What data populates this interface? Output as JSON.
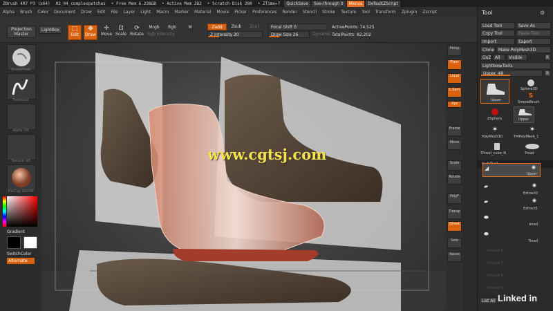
{
  "titlebar": {
    "app": "ZBrush 4R7 P3 (x64)",
    "doc": "02_04_complexpatches",
    "free_mem": "• Free Mem 6.238GB",
    "active_mem": "• Active Mem 382",
    "scratch": "• Scratch Disk 280",
    "ztime": "• ZTime▸7",
    "quicksave": "QuickSave",
    "see_through": "See-through  0",
    "menus": "Menus",
    "default_zscript": "DefaultZScript"
  },
  "menubar": [
    "Alpha",
    "Brush",
    "Color",
    "Document",
    "Draw",
    "Edit",
    "File",
    "Layer",
    "Light",
    "Macro",
    "Marker",
    "Material",
    "Movie",
    "Picker",
    "Preferences",
    "Render",
    "Stencil",
    "Stroke",
    "Texture",
    "Tool",
    "Transform",
    "Zplugin",
    "Zscript"
  ],
  "toolbar": {
    "projection_master": "Projection Master",
    "lightbox": "LightBox",
    "edit": "Edit",
    "draw": "Draw",
    "move": "Move",
    "scale": "Scale",
    "rotate": "Rotate",
    "mrgb": "Mrgb",
    "rgb": "Rgb",
    "m": "M",
    "rgb_intensity": "Rgb Intensity",
    "zadd": "Zadd",
    "zsub": "Zsub",
    "zcut": "Zcut",
    "z_intensity": "Z Intensity 20",
    "focal_shift": "Focal Shift 0",
    "draw_size": "Draw Size 26",
    "dynamic": "Dynamic",
    "active_points": "ActivePoints: 74,525",
    "total_points": "TotalPoints: 82,202",
    "z_intensity_value": 0.2,
    "draw_size_value": 0.26
  },
  "leftshelf": {
    "labels": [
      "SnakeHook",
      "Freehand",
      "Alpha Off",
      "Texture Off",
      "MatCap Skin06"
    ],
    "gradient": "Gradient",
    "switchcolor": "SwitchColor",
    "alternate": "Alternate"
  },
  "viewport": {
    "watermark": "www.cgtsj.com"
  },
  "righttools": [
    "Persp",
    "Floor",
    "Local",
    "L.Sym",
    "Xyz",
    "Frame",
    "Move",
    "Scale",
    "Rotate",
    "PolyF",
    "Transp",
    "Ghost",
    "Solo",
    "Xpose"
  ],
  "toolpanel": {
    "title": "Tool",
    "load_tool": "Load Tool",
    "save_as": "Save As",
    "copy_tool": "Copy Tool",
    "paste_tool": "Paste Tool",
    "import": "Import",
    "export": "Export",
    "clone": "Clone",
    "make_polymesh": "Make PolyMesh3D",
    "goz": "GoZ",
    "all": "All",
    "visible": "Visible",
    "r": "R",
    "lightbox_tools": "Lightbox▸Tools",
    "upper_slider": "Upper. 48",
    "upper_value": 0.48,
    "tools": [
      "Upper",
      "Sphere3D",
      "SimpleBrush",
      "ZSphere",
      "Upper",
      "PolyMesh3D",
      "TMPolyMesh_1",
      "TPoseI_cube_N",
      "Tread"
    ],
    "subtool_header": "SubTool",
    "subtools": [
      "Upper",
      "Extract2",
      "Extract1",
      "tread",
      "Tread"
    ],
    "empty_slots": [
      "Unused 6",
      "Unused 7",
      "Unused 8",
      "Unused 9"
    ],
    "list_all": "List All"
  },
  "colors": {
    "accent": "#e36b1b",
    "watermark": "#f4e14a"
  },
  "branding": "Linked in"
}
